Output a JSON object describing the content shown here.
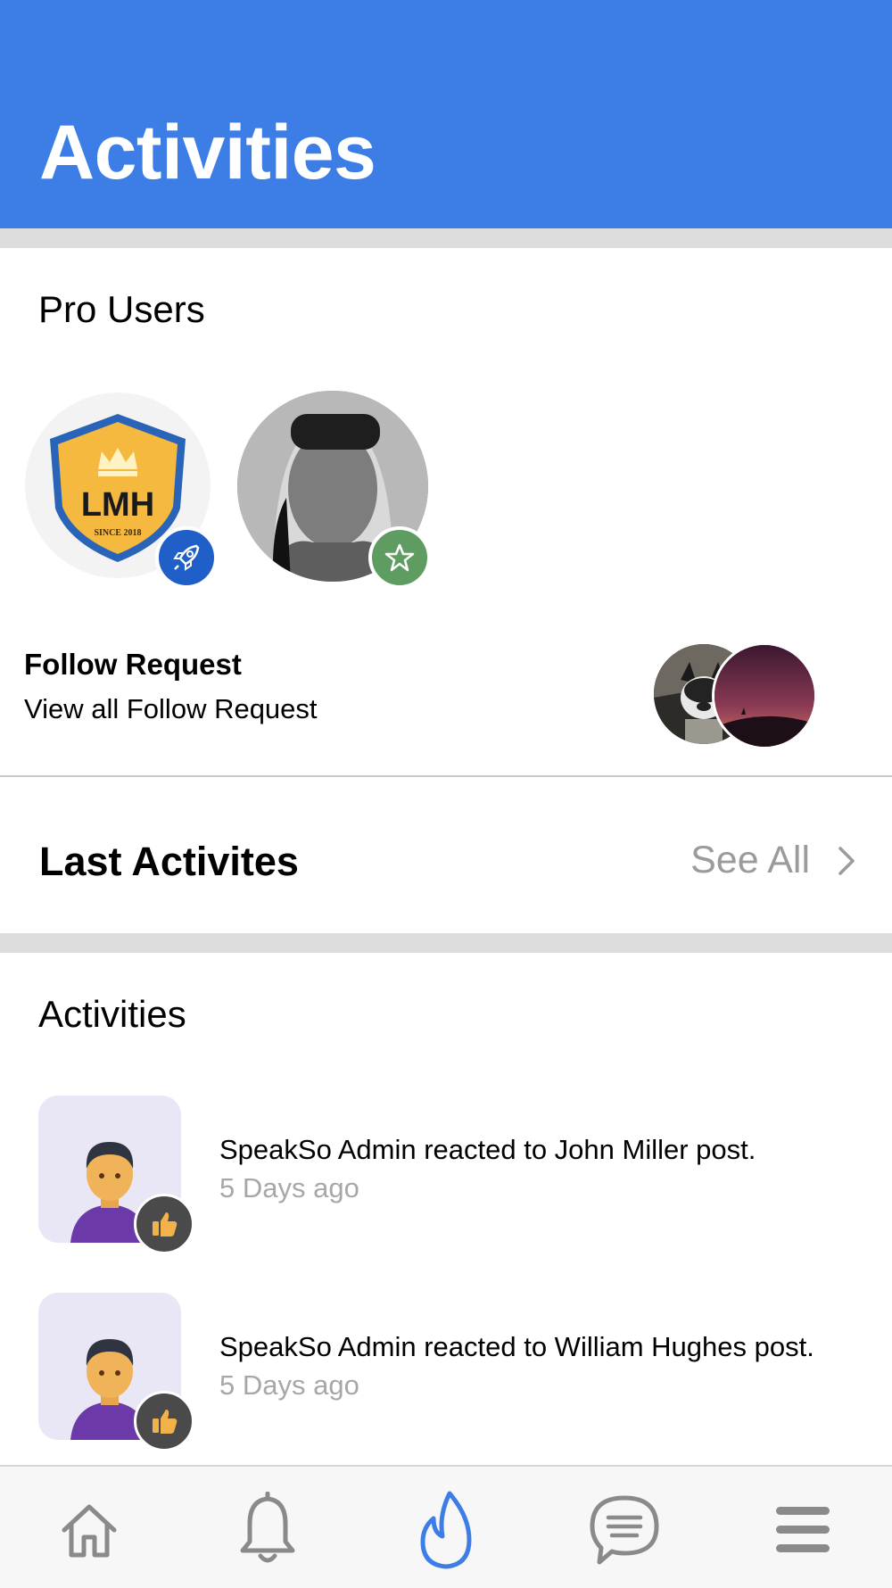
{
  "header": {
    "title": "Activities",
    "bg_color": "#3d7ee6"
  },
  "pro_users": {
    "title": "Pro Users",
    "users": [
      {
        "avatar": "lmh-shield-logo",
        "logo_text": "LMH",
        "logo_sub": "SINCE 2018",
        "badge_icon": "rocket-icon",
        "badge_color": "#1f5fc7"
      },
      {
        "avatar": "user-photo",
        "badge_icon": "star-icon",
        "badge_color": "#5e9c61"
      }
    ]
  },
  "follow_request": {
    "title": "Follow Request",
    "subtitle": "View all Follow Request"
  },
  "last_activities": {
    "title": "Last Activites",
    "see_all": "See All"
  },
  "activities": {
    "title": "Activities",
    "items": [
      {
        "text": "SpeakSo Admin reacted to John Miller post.",
        "time": "5 Days ago",
        "badge_icon": "thumbs-up-icon"
      },
      {
        "text": "SpeakSo Admin reacted to William Hughes post.",
        "time": "5 Days ago",
        "badge_icon": "thumbs-up-icon"
      }
    ]
  },
  "tabbar": {
    "active_color": "#3d7ee6",
    "inactive_color": "#8a8a8a",
    "tabs": [
      {
        "icon": "home-icon",
        "active": false
      },
      {
        "icon": "bell-icon",
        "active": false
      },
      {
        "icon": "flame-icon",
        "active": true
      },
      {
        "icon": "chat-icon",
        "active": false
      },
      {
        "icon": "menu-icon",
        "active": false
      }
    ]
  }
}
